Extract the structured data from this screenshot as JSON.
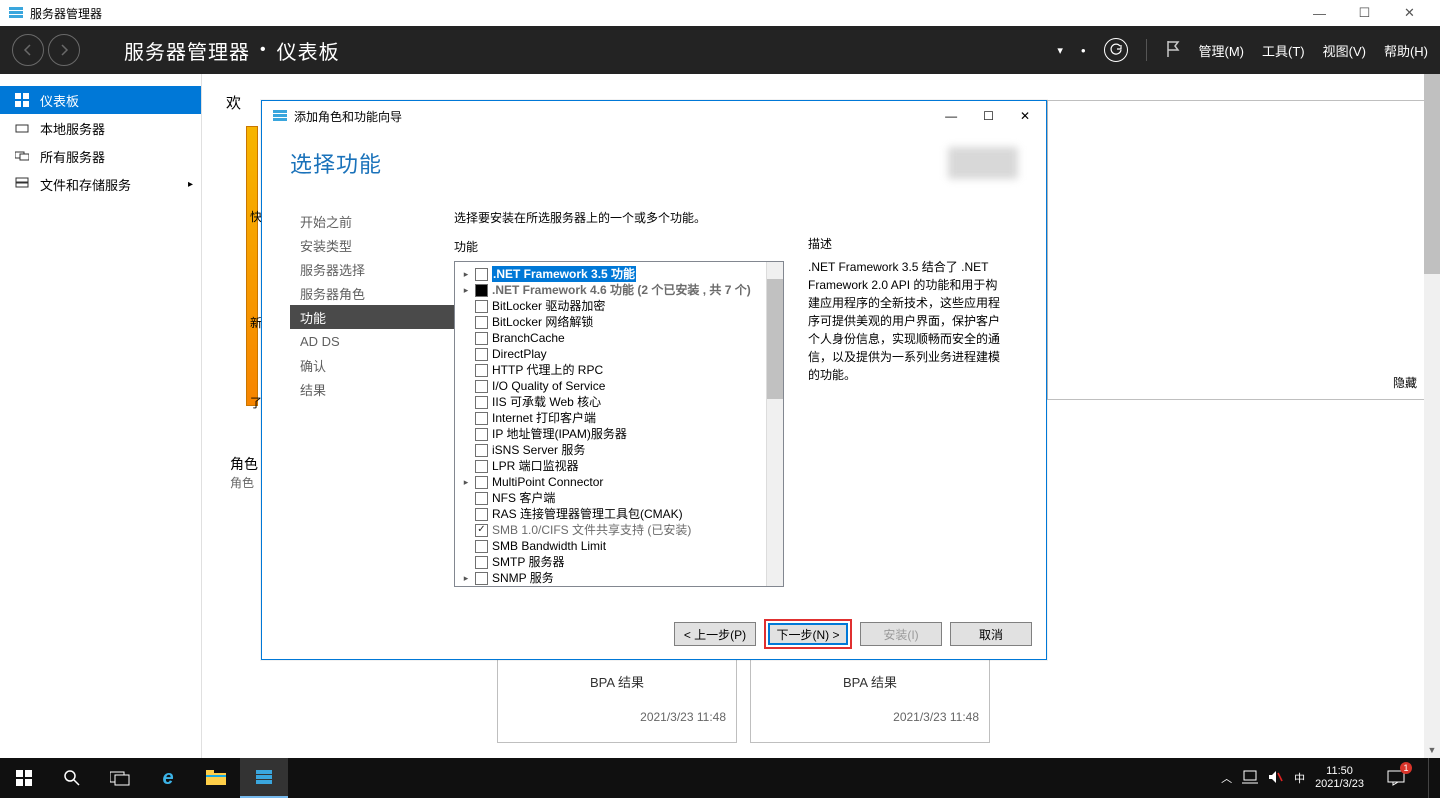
{
  "window": {
    "title": "服务器管理器",
    "minimize": "—",
    "maximize": "☐",
    "close": "✕"
  },
  "header": {
    "breadcrumb_app": "服务器管理器",
    "breadcrumb_page": "仪表板",
    "menu": {
      "manage": "管理(M)",
      "tools": "工具(T)",
      "view": "视图(V)",
      "help": "帮助(H)"
    }
  },
  "sidebar": {
    "items": [
      {
        "label": "仪表板",
        "active": true,
        "icon": "dashboard"
      },
      {
        "label": "本地服务器",
        "active": false,
        "icon": "server"
      },
      {
        "label": "所有服务器",
        "active": false,
        "icon": "servers"
      },
      {
        "label": "文件和存储服务",
        "active": false,
        "icon": "storage",
        "arrow": true
      }
    ]
  },
  "content": {
    "welcome": "欢",
    "orange": {
      "quick": "快",
      "new": "新",
      "learn": "了"
    },
    "section_title": "角色",
    "section_sub": "角色",
    "bpa_label": "BPA 结果",
    "tile_time": "2021/3/23 11:48",
    "hide": "隐藏"
  },
  "dialog": {
    "title": "添加角色和功能向导",
    "head": "选择功能",
    "nav": [
      "开始之前",
      "安装类型",
      "服务器选择",
      "服务器角色",
      "功能",
      "AD DS",
      "确认",
      "结果"
    ],
    "nav_active_index": 4,
    "intro": "选择要安装在所选服务器上的一个或多个功能。",
    "features_label": "功能",
    "desc_label": "描述",
    "desc_text": ".NET Framework 3.5 结合了 .NET Framework 2.0 API 的功能和用于构建应用程序的全新技术，这些应用程序可提供美观的用户界面，保护客户个人身份信息，实现顺畅而安全的通信，以及提供为一系列业务进程建模的功能。",
    "features": [
      {
        "exp": "▸",
        "state": "empty",
        "label": ".NET Framework 3.5 功能",
        "selected": true
      },
      {
        "exp": "▸",
        "state": "filled",
        "label": ".NET Framework 4.6 功能 (2 个已安装 , 共 7 个)",
        "gray": true
      },
      {
        "state": "empty",
        "label": "BitLocker 驱动器加密"
      },
      {
        "state": "empty",
        "label": "BitLocker 网络解锁"
      },
      {
        "state": "empty",
        "label": "BranchCache"
      },
      {
        "state": "empty",
        "label": "DirectPlay"
      },
      {
        "state": "empty",
        "label": "HTTP 代理上的 RPC"
      },
      {
        "state": "empty",
        "label": "I/O Quality of Service"
      },
      {
        "state": "empty",
        "label": "IIS 可承载 Web 核心"
      },
      {
        "state": "empty",
        "label": "Internet 打印客户端"
      },
      {
        "state": "empty",
        "label": "IP 地址管理(IPAM)服务器"
      },
      {
        "state": "empty",
        "label": "iSNS Server 服务"
      },
      {
        "state": "empty",
        "label": "LPR 端口监视器"
      },
      {
        "exp": "▸",
        "state": "empty",
        "label": "MultiPoint Connector"
      },
      {
        "state": "empty",
        "label": "NFS 客户端"
      },
      {
        "state": "empty",
        "label": "RAS 连接管理器管理工具包(CMAK)"
      },
      {
        "state": "checked",
        "label": "SMB 1.0/CIFS 文件共享支持 (已安装)",
        "muted": true
      },
      {
        "state": "empty",
        "label": "SMB Bandwidth Limit"
      },
      {
        "state": "empty",
        "label": "SMTP 服务器"
      },
      {
        "exp": "▸",
        "state": "empty",
        "label": "SNMP 服务"
      }
    ],
    "buttons": {
      "prev": "< 上一步(P)",
      "next": "下一步(N) >",
      "install": "安装(I)",
      "cancel": "取消"
    }
  },
  "taskbar": {
    "time": "11:50",
    "date": "2021/3/23",
    "ime": "中"
  }
}
